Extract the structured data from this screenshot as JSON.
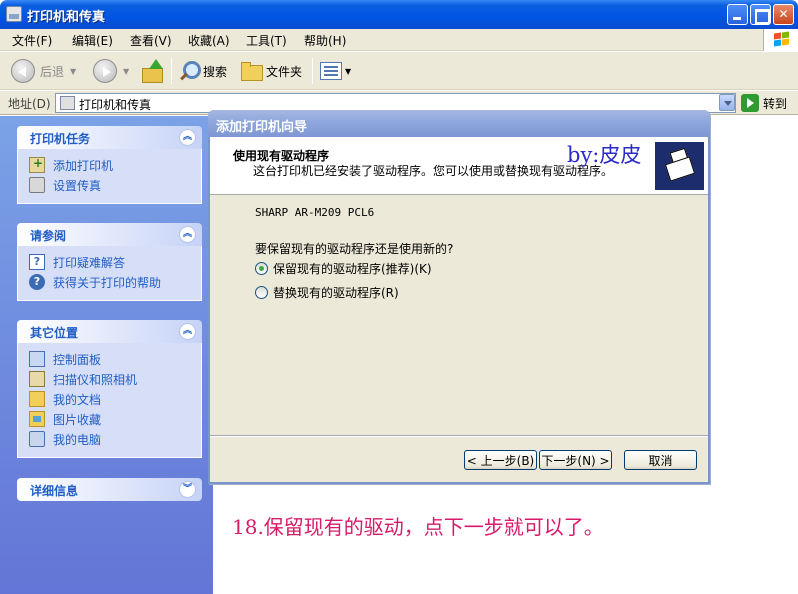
{
  "window": {
    "title": "打印机和传真"
  },
  "menu": [
    "文件(F)",
    "编辑(E)",
    "查看(V)",
    "收藏(A)",
    "工具(T)",
    "帮助(H)"
  ],
  "toolbar": {
    "back_label": "后退",
    "search_label": "搜索",
    "folders_label": "文件夹"
  },
  "address": {
    "label": "地址(D)",
    "value": "打印机和传真",
    "go_label": "转到"
  },
  "left_pane": {
    "printer_tasks": {
      "title": "打印机任务",
      "items": [
        "添加打印机",
        "设置传真"
      ]
    },
    "see_also": {
      "title": "请参阅",
      "items": [
        "打印疑难解答",
        "获得关于打印的帮助"
      ]
    },
    "other_places": {
      "title": "其它位置",
      "items": [
        "控制面板",
        "扫描仪和照相机",
        "我的文档",
        "图片收藏",
        "我的电脑"
      ]
    },
    "details": {
      "title": "详细信息"
    }
  },
  "wizard": {
    "title": "添加打印机向导",
    "header_title": "使用现有驱动程序",
    "header_subtitle": "这台打印机已经安装了驱动程序。您可以使用或替换现有驱动程序。",
    "watermark": "by:皮皮",
    "driver_name": "SHARP AR-M209 PCL6",
    "question": "要保留现有的驱动程序还是使用新的?",
    "options": [
      "保留现有的驱动程序(推荐)(K)",
      "替换现有的驱动程序(R)"
    ],
    "selected_option": 0,
    "back_button": "< 上一步(B)",
    "next_button": "下一步(N) >",
    "cancel_button": "取消"
  },
  "caption": "18.保留现有的驱动，点下一步就可以了。"
}
